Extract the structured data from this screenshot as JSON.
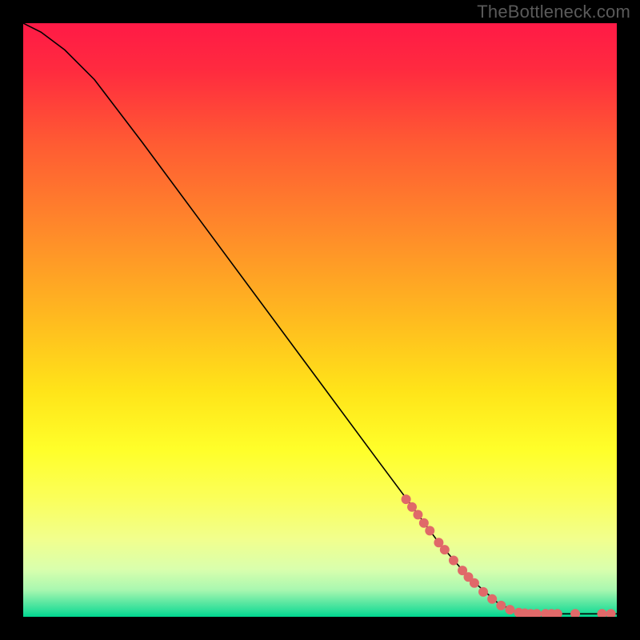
{
  "watermark": "TheBottleneck.com",
  "chart_data": {
    "type": "line",
    "title": "",
    "xlabel": "",
    "ylabel": "",
    "xlim": [
      0,
      100
    ],
    "ylim": [
      0,
      100
    ],
    "curve": {
      "name": "bottleneck-curve",
      "color": "#000000",
      "points": [
        {
          "x": 0,
          "y": 100
        },
        {
          "x": 3,
          "y": 98.5
        },
        {
          "x": 7,
          "y": 95.5
        },
        {
          "x": 12,
          "y": 90.5
        },
        {
          "x": 20,
          "y": 80
        },
        {
          "x": 30,
          "y": 66.5
        },
        {
          "x": 40,
          "y": 53
        },
        {
          "x": 50,
          "y": 39.5
        },
        {
          "x": 60,
          "y": 26
        },
        {
          "x": 65,
          "y": 19.3
        },
        {
          "x": 70,
          "y": 12.5
        },
        {
          "x": 75,
          "y": 6.7
        },
        {
          "x": 80,
          "y": 2.3
        },
        {
          "x": 83,
          "y": 0.8
        },
        {
          "x": 86,
          "y": 0.5
        },
        {
          "x": 90,
          "y": 0.5
        },
        {
          "x": 95,
          "y": 0.5
        },
        {
          "x": 100,
          "y": 0.5
        }
      ]
    },
    "markers": {
      "name": "data-markers",
      "color": "#e06969",
      "radius_px": 6,
      "points": [
        {
          "x": 64.5,
          "y": 19.8
        },
        {
          "x": 65.5,
          "y": 18.5
        },
        {
          "x": 66.5,
          "y": 17.2
        },
        {
          "x": 67.5,
          "y": 15.8
        },
        {
          "x": 68.5,
          "y": 14.5
        },
        {
          "x": 70.0,
          "y": 12.5
        },
        {
          "x": 71.0,
          "y": 11.3
        },
        {
          "x": 72.5,
          "y": 9.5
        },
        {
          "x": 74.0,
          "y": 7.8
        },
        {
          "x": 75.0,
          "y": 6.7
        },
        {
          "x": 76.0,
          "y": 5.7
        },
        {
          "x": 77.5,
          "y": 4.2
        },
        {
          "x": 79.0,
          "y": 3.0
        },
        {
          "x": 80.5,
          "y": 1.9
        },
        {
          "x": 82.0,
          "y": 1.2
        },
        {
          "x": 83.5,
          "y": 0.7
        },
        {
          "x": 84.5,
          "y": 0.6
        },
        {
          "x": 85.5,
          "y": 0.5
        },
        {
          "x": 86.5,
          "y": 0.5
        },
        {
          "x": 88.0,
          "y": 0.5
        },
        {
          "x": 89.0,
          "y": 0.5
        },
        {
          "x": 90.0,
          "y": 0.5
        },
        {
          "x": 93.0,
          "y": 0.5
        },
        {
          "x": 97.5,
          "y": 0.5
        },
        {
          "x": 99.0,
          "y": 0.5
        }
      ]
    },
    "background_gradient": {
      "stops": [
        {
          "offset": 0.0,
          "color": "#ff1a46"
        },
        {
          "offset": 0.08,
          "color": "#ff2b3f"
        },
        {
          "offset": 0.2,
          "color": "#ff5a33"
        },
        {
          "offset": 0.35,
          "color": "#ff8a2a"
        },
        {
          "offset": 0.5,
          "color": "#ffbb1f"
        },
        {
          "offset": 0.62,
          "color": "#ffe419"
        },
        {
          "offset": 0.72,
          "color": "#ffff2a"
        },
        {
          "offset": 0.8,
          "color": "#fbff5a"
        },
        {
          "offset": 0.87,
          "color": "#f1ff8e"
        },
        {
          "offset": 0.92,
          "color": "#d9ffad"
        },
        {
          "offset": 0.955,
          "color": "#a8f7b0"
        },
        {
          "offset": 0.975,
          "color": "#5fe8a2"
        },
        {
          "offset": 0.99,
          "color": "#2adf99"
        },
        {
          "offset": 1.0,
          "color": "#00d68f"
        }
      ]
    }
  }
}
